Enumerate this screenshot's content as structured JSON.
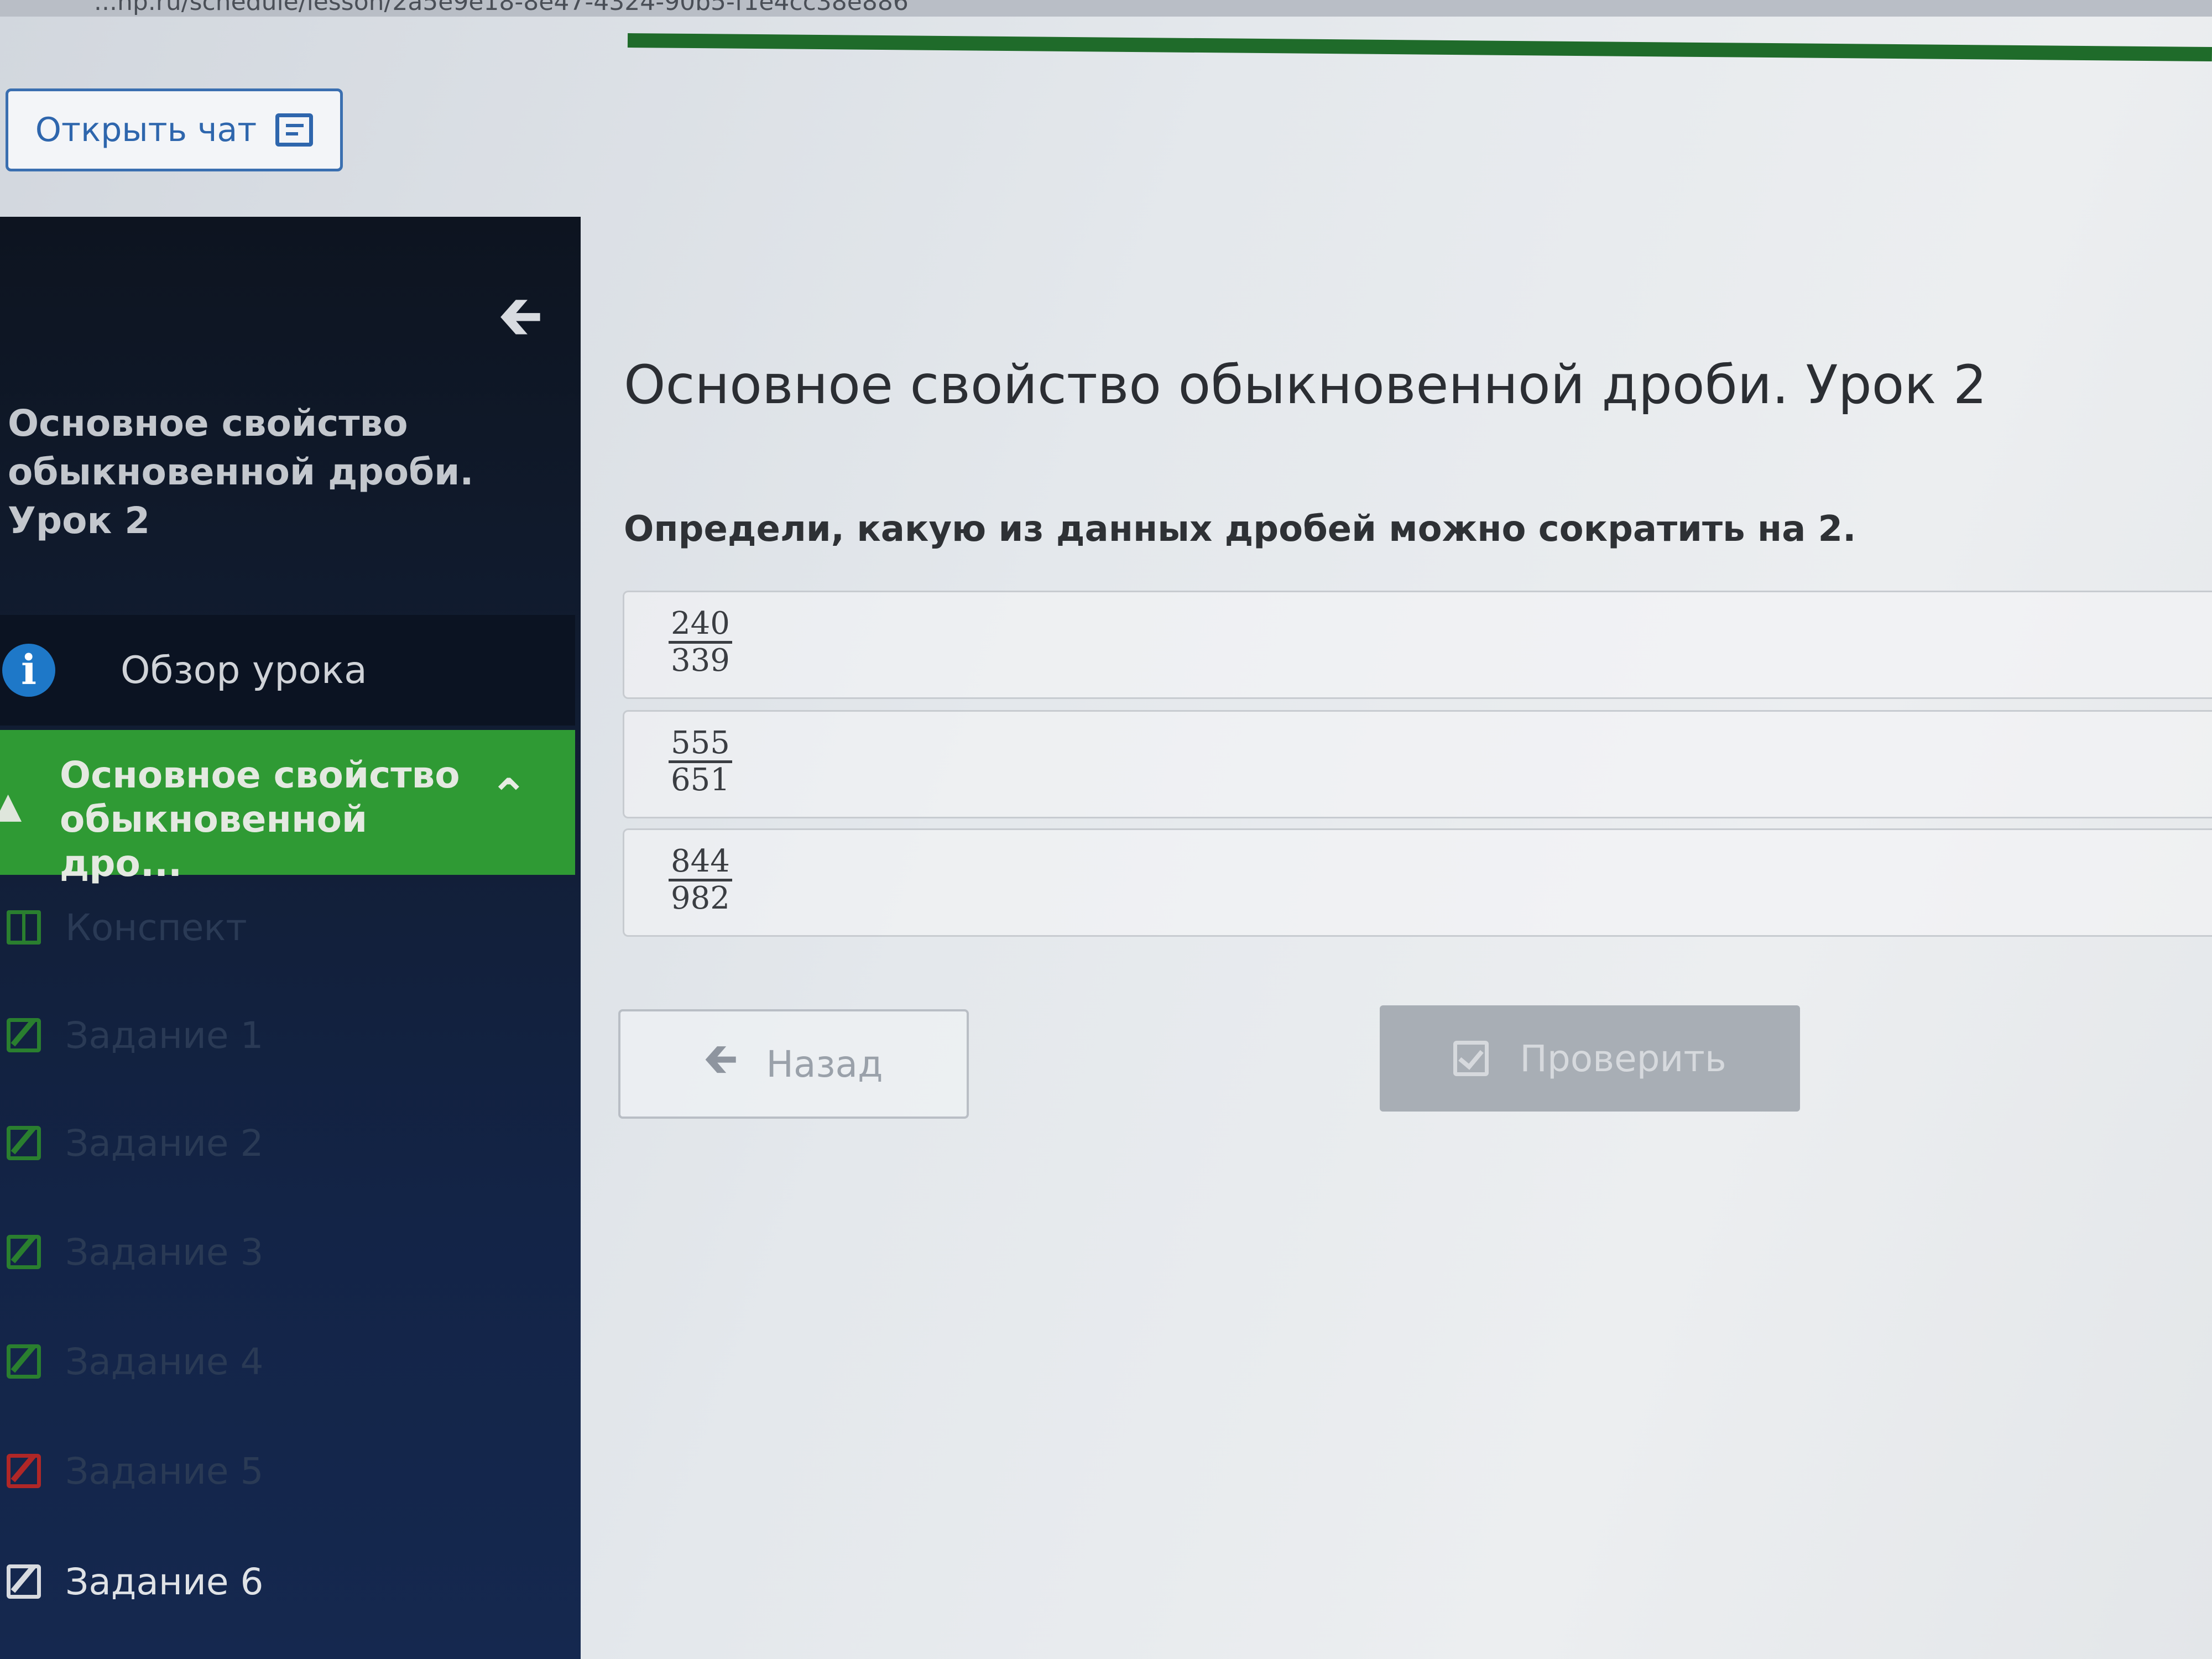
{
  "browser": {
    "url_fragment": "...np.ru/schedule/lesson/2a5e9e18-8e47-4324-90b5-f1e4cc38e886"
  },
  "header": {
    "open_chat_label": "Открыть чат"
  },
  "sidebar": {
    "title": "Основное свойство обыкновенной дроби. Урок 2",
    "overview_label": "Обзор урока",
    "active_section_label": "Основное свойство обыкновенной дро...",
    "items": [
      {
        "label": "Конспект"
      },
      {
        "label": "Задание 1"
      },
      {
        "label": "Задание 2"
      },
      {
        "label": "Задание 3"
      },
      {
        "label": "Задание 4"
      },
      {
        "label": "Задание 5"
      },
      {
        "label": "Задание 6"
      }
    ]
  },
  "main": {
    "title": "Основное свойство обыкновенной дроби. Урок 2",
    "question": "Определи, какую из данных дробей можно сократить на 2.",
    "options": [
      {
        "numerator": "240",
        "denominator": "339"
      },
      {
        "numerator": "555",
        "denominator": "651"
      },
      {
        "numerator": "844",
        "denominator": "982"
      }
    ],
    "back_label": "Назад",
    "check_label": "Проверить"
  },
  "colors": {
    "sidebar_bg": "#132447",
    "active_green": "#2f9a34",
    "link_blue": "#2e66ad",
    "progress_green": "#1f6b2a"
  }
}
